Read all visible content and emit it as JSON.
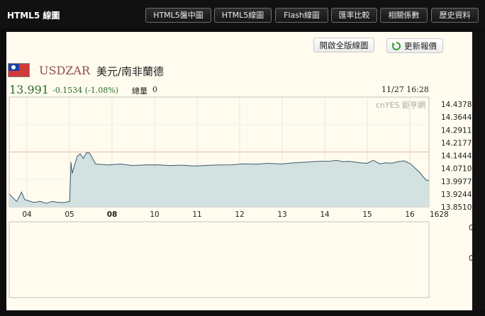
{
  "app": {
    "title": "HTML5 線圖"
  },
  "tabs": [
    {
      "label": "HTML5盤中圖"
    },
    {
      "label": "HTML5線圖"
    },
    {
      "label": "Flash線圖"
    },
    {
      "label": "匯率比較"
    },
    {
      "label": "相關係數"
    },
    {
      "label": "歷史資料"
    }
  ],
  "buttons": {
    "fullscreen_label": "開啟全版線圖",
    "refresh_label": "更新報價"
  },
  "quote": {
    "symbol": "USDZAR",
    "name": "美元/南非蘭德",
    "price": "13.991",
    "change": "-0.1534 (-1.08%)",
    "volume_label": "總量",
    "volume_value": "0",
    "datetime": "11/27 16:28",
    "watermark": "cnYES 鉅亨網"
  },
  "colors": {
    "line": "#3d5a6e",
    "area": "#d3e1e1",
    "reference_line": "#e3b9a6",
    "price_text": "#2a6a2a"
  },
  "chart_data": {
    "type": "area",
    "y_ticks": [
      "14.4378",
      "14.3644",
      "14.2911",
      "14.2177",
      "14.1444",
      "14.0710",
      "13.9977",
      "13.9244",
      "13.8510"
    ],
    "ylim": [
      13.851,
      14.4378
    ],
    "reference_value": 14.1444,
    "x_ticks": [
      "04",
      "05",
      "08",
      "10",
      "11",
      "12",
      "13",
      "14",
      "15",
      "16",
      "1628"
    ],
    "x": [
      0,
      1.2,
      2,
      2.5,
      3,
      4,
      5,
      6,
      7,
      8,
      9,
      9.8,
      10,
      10.2,
      11,
      11.5,
      12,
      12.5,
      13,
      14,
      16,
      18,
      20,
      22,
      24,
      26,
      28,
      30,
      32,
      34,
      36,
      38,
      40,
      42,
      44,
      46,
      48,
      50,
      52,
      53,
      54,
      55,
      56,
      57,
      58,
      59,
      60,
      61,
      62,
      63,
      64,
      65,
      66,
      66.5,
      67,
      67.5,
      68
    ],
    "values": [
      13.92,
      13.88,
      13.93,
      13.89,
      13.885,
      13.875,
      13.88,
      13.87,
      13.88,
      13.875,
      13.875,
      13.88,
      14.09,
      14.03,
      14.12,
      14.135,
      14.11,
      14.14,
      14.14,
      14.08,
      14.075,
      14.08,
      14.072,
      14.075,
      14.076,
      14.072,
      14.074,
      14.07,
      14.073,
      14.075,
      14.076,
      14.081,
      14.079,
      14.084,
      14.08,
      14.086,
      14.09,
      14.094,
      14.095,
      14.1,
      14.093,
      14.094,
      14.091,
      14.086,
      14.084,
      14.1,
      14.081,
      14.087,
      14.085,
      14.093,
      14.097,
      14.082,
      14.05,
      14.035,
      14.015,
      13.995,
      13.991
    ]
  }
}
